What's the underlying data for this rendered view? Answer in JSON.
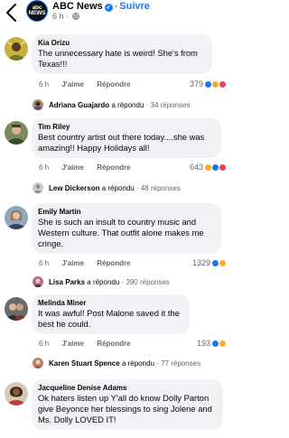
{
  "header": {
    "page_name": "ABC News",
    "follow_label": "Suivre",
    "time": "6 h",
    "logo_text": "abc NEWS"
  },
  "comments": [
    {
      "author": "Kia Orizu",
      "text": "The unnecessary hate is weird! She's from Texas!!!",
      "time": "6 h",
      "like_label": "J'aime",
      "reply_label": "Répondre",
      "reaction_count": "379",
      "reactions": [
        "like",
        "haha",
        "love"
      ],
      "reply": {
        "name": "Adriana Guajardo",
        "verb": "a répondu",
        "count": "34 réponses"
      }
    },
    {
      "author": "Tim Riley",
      "text": "Best country artist out there today....she was amazing!! Happy Holidays all!",
      "time": "6 h",
      "like_label": "J'aime",
      "reply_label": "Répondre",
      "reaction_count": "643",
      "reactions": [
        "haha",
        "like",
        "love"
      ],
      "reply": {
        "name": "Lew Dickerson",
        "verb": "a répondu",
        "count": "48 réponses"
      }
    },
    {
      "author": "Emily Martin",
      "text": "She is such an insult to country music and Western culture. That outfit alone makes me cringe.",
      "time": "6 h",
      "like_label": "J'aime",
      "reply_label": "Répondre",
      "reaction_count": "1329",
      "reactions": [
        "like",
        "haha"
      ],
      "reply": {
        "name": "Lisa Parks",
        "verb": "a répondu",
        "count": "390 réponses"
      }
    },
    {
      "author": "Melinda Miner",
      "text": "It was awful! Post Malone saved it the best he could.",
      "time": "6 h",
      "like_label": "J'aime",
      "reply_label": "Répondre",
      "reaction_count": "193",
      "reactions": [
        "like",
        "haha"
      ],
      "reply": {
        "name": "Karen Stuart Spence",
        "verb": "a répondu",
        "count": "77 réponses"
      }
    },
    {
      "author": "Jacqueline Denise Adams",
      "text": "Ok haters listen up Y'all do know Dolly Parton give Beyonce her blessings to sing Jolene and Ms. Dolly LOVED IT!"
    }
  ],
  "colors": {
    "accent": "#1877f2",
    "bubble": "#f0f2f5",
    "secondary_text": "#65676b",
    "love": "#f33e58",
    "haha": "#f7b125"
  },
  "icons": [
    "back-arrow-icon",
    "verified-badge-icon",
    "globe-icon",
    "like-reaction-icon",
    "haha-reaction-icon",
    "love-reaction-icon"
  ]
}
